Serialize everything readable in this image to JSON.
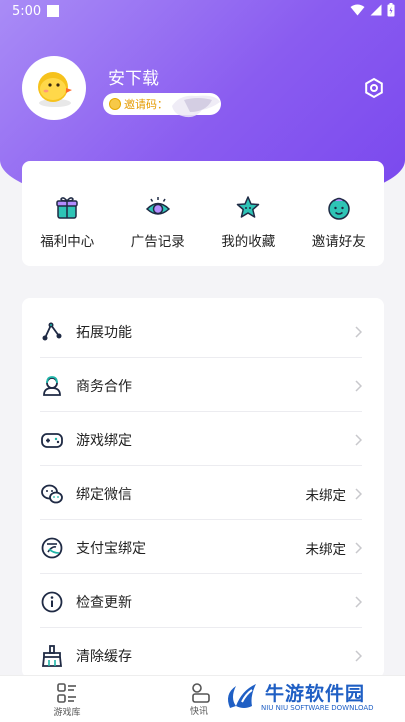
{
  "status_bar": {
    "time": "5:00"
  },
  "profile": {
    "username": "安下载",
    "invite_label": "邀请码："
  },
  "quick_actions": [
    {
      "label": "福利中心",
      "icon": "gift-icon"
    },
    {
      "label": "广告记录",
      "icon": "eye-icon"
    },
    {
      "label": "我的收藏",
      "icon": "star-icon"
    },
    {
      "label": "邀请好友",
      "icon": "friend-icon"
    }
  ],
  "menu": [
    {
      "label": "拓展功能",
      "icon": "extension-icon",
      "value": ""
    },
    {
      "label": "商务合作",
      "icon": "business-icon",
      "value": ""
    },
    {
      "label": "游戏绑定",
      "icon": "gamepad-icon",
      "value": ""
    },
    {
      "label": "绑定微信",
      "icon": "wechat-icon",
      "value": "未绑定"
    },
    {
      "label": "支付宝绑定",
      "icon": "alipay-icon",
      "value": "未绑定"
    },
    {
      "label": "检查更新",
      "icon": "info-icon",
      "value": ""
    },
    {
      "label": "清除缓存",
      "icon": "broom-icon",
      "value": ""
    }
  ],
  "bottom_nav": [
    {
      "label": "游戏库",
      "icon": "game-library-icon"
    },
    {
      "label": "快讯",
      "icon": "news-icon"
    }
  ],
  "watermark": {
    "title": "牛游软件园",
    "subtitle": "NIU NIU SOFTWARE DOWNLOAD"
  },
  "colors": {
    "accent": "#7a48ee",
    "header_light": "#a98cf6",
    "icon_teal": "#1fb5a8"
  }
}
